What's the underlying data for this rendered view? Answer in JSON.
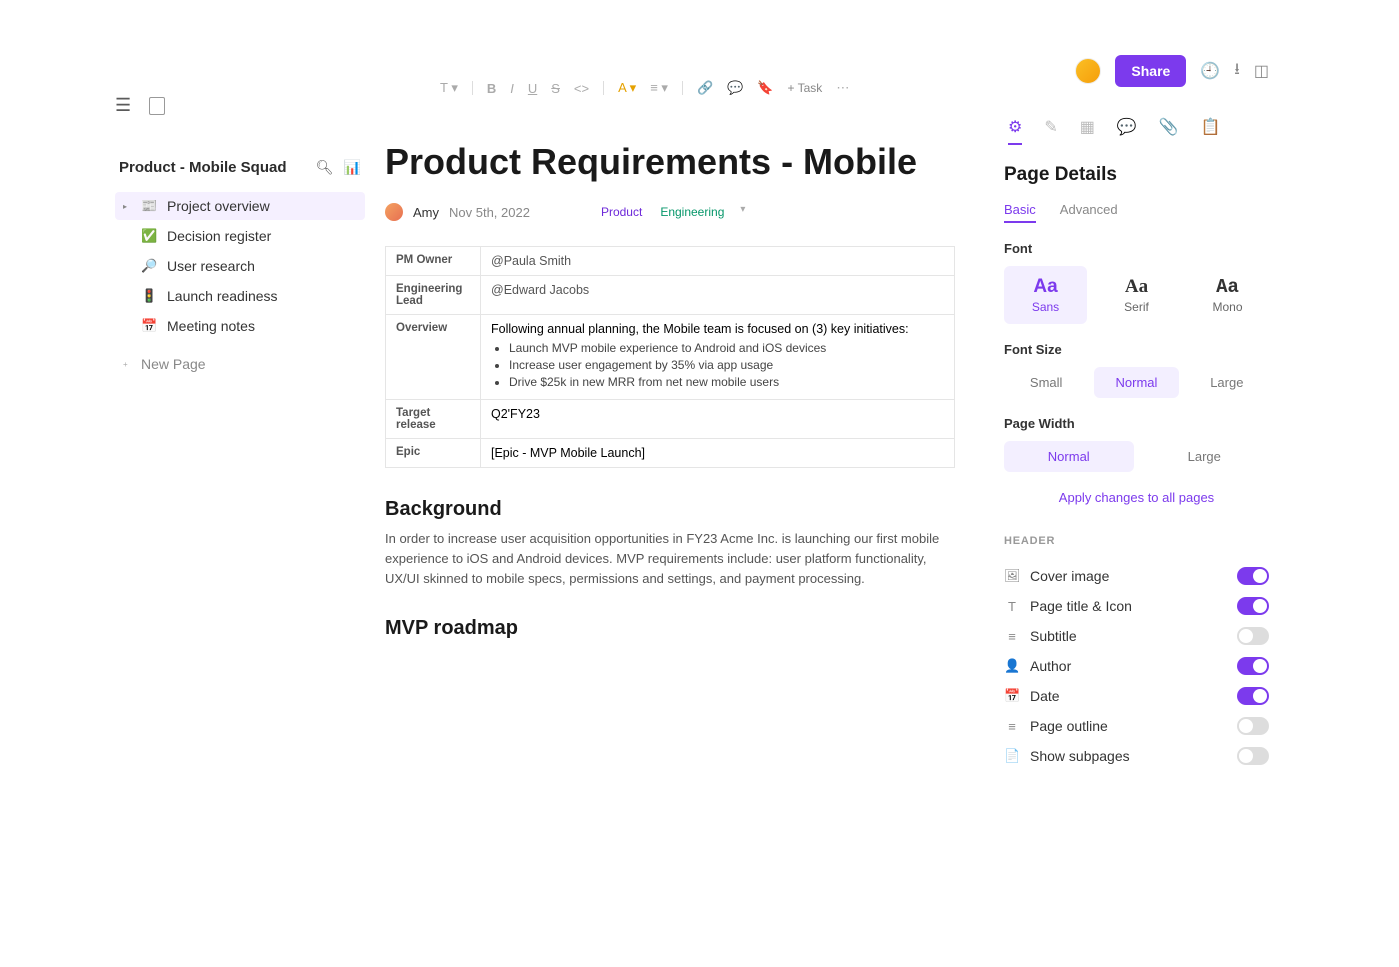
{
  "sidebar": {
    "title": "Product - Mobile Squad",
    "items": [
      {
        "icon": "📰",
        "label": "Project overview"
      },
      {
        "icon": "✅",
        "label": "Decision register"
      },
      {
        "icon": "🔎",
        "label": "User research"
      },
      {
        "icon": "🚦",
        "label": "Launch readiness"
      },
      {
        "icon": "📅",
        "label": "Meeting notes"
      }
    ],
    "new_page": "New Page"
  },
  "toolbar": {
    "bold": "B",
    "italic": "I",
    "underline": "U",
    "strike": "S",
    "code": "<>",
    "color_a": "A",
    "align": "≡",
    "attach": "📎",
    "comment": "💬",
    "image": "🖼",
    "task": "+ Task",
    "more": "⋯"
  },
  "doc": {
    "title": "Product Requirements - Mobile",
    "author": "Amy",
    "date": "Nov 5th, 2022",
    "tags": [
      "Product",
      "Engineering"
    ],
    "table": {
      "pm_owner_label": "PM Owner",
      "pm_owner": "@Paula Smith",
      "eng_lead_label": "Engineering Lead",
      "eng_lead": "@Edward Jacobs",
      "overview_label": "Overview",
      "overview_intro": "Following annual planning, the Mobile team is focused on (3) key initiatives:",
      "overview_items": [
        "Launch MVP mobile experience to Android and iOS devices",
        "Increase user engagement by 35% via app usage",
        "Drive $25k in new MRR from net new mobile users"
      ],
      "target_label": "Target release",
      "target": "Q2'FY23",
      "epic_label": "Epic",
      "epic": "[Epic - MVP Mobile Launch]"
    },
    "background_h": "Background",
    "background": "In order to increase user acquisition opportunities in FY23 Acme Inc. is launching our first mobile experience to iOS and Android devices. MVP requirements include: user platform functionality, UX/UI skinned to mobile specs, permissions and settings, and payment processing.",
    "mvp_h": "MVP roadmap"
  },
  "panel": {
    "share": "Share",
    "title": "Page Details",
    "subtabs": {
      "basic": "Basic",
      "advanced": "Advanced"
    },
    "font_label": "Font",
    "fonts": {
      "sans": "Sans",
      "serif": "Serif",
      "mono": "Mono",
      "aa": "Aa"
    },
    "size_label": "Font Size",
    "sizes": {
      "small": "Small",
      "normal": "Normal",
      "large": "Large"
    },
    "width_label": "Page Width",
    "widths": {
      "normal": "Normal",
      "large": "Large"
    },
    "apply": "Apply changes to all pages",
    "header_section": "HEADER",
    "toggles": [
      {
        "icon": "🖼",
        "label": "Cover image",
        "on": true
      },
      {
        "icon": "T",
        "label": "Page title & Icon",
        "on": true
      },
      {
        "icon": "≡",
        "label": "Subtitle",
        "on": false
      },
      {
        "icon": "👤",
        "label": "Author",
        "on": true
      },
      {
        "icon": "📅",
        "label": "Date",
        "on": true
      },
      {
        "icon": "≡",
        "label": "Page outline",
        "on": false
      },
      {
        "icon": "📄",
        "label": "Show subpages",
        "on": false
      }
    ]
  }
}
